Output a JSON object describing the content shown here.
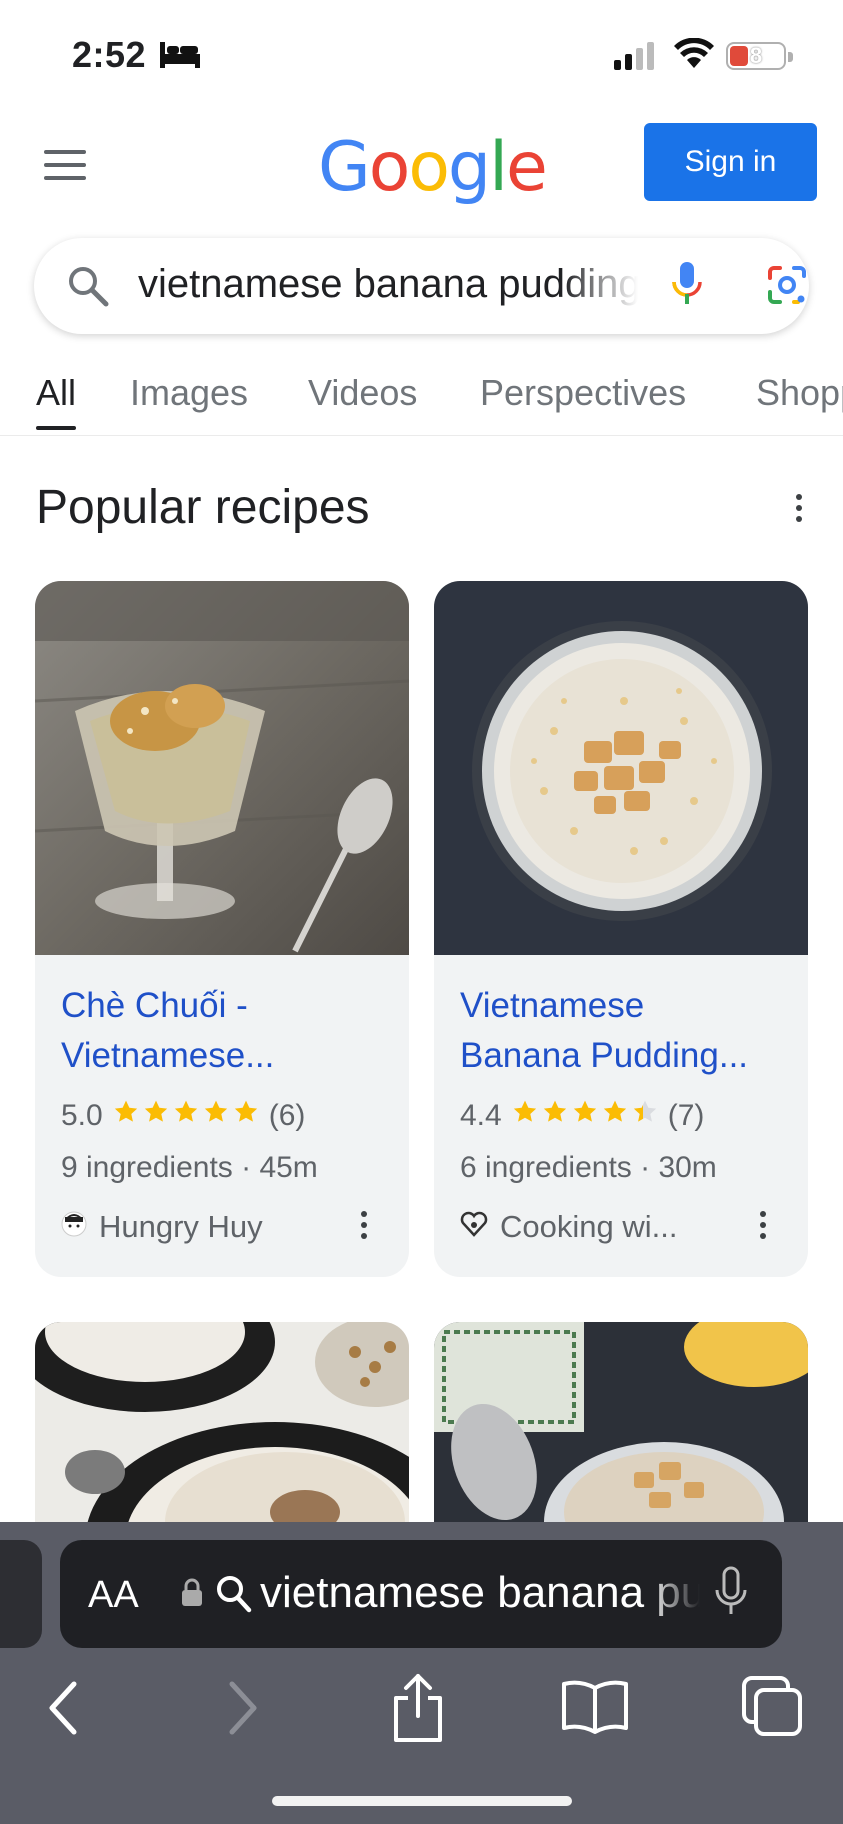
{
  "status_bar": {
    "time": "2:52",
    "battery_level": "8",
    "icons": [
      "sleep-bed-icon",
      "cellular-signal-icon",
      "wifi-icon",
      "battery-icon"
    ]
  },
  "header": {
    "logo_letters": [
      "G",
      "o",
      "o",
      "g",
      "l",
      "e"
    ],
    "sign_in_label": "Sign in",
    "icons": [
      "hamburger-menu-icon"
    ]
  },
  "search": {
    "query": "vietnamese banana pudding",
    "icons": [
      "search-icon",
      "voice-search-icon",
      "google-lens-icon"
    ]
  },
  "tabs": [
    {
      "label": "All",
      "active": true
    },
    {
      "label": "Images",
      "active": false
    },
    {
      "label": "Videos",
      "active": false
    },
    {
      "label": "Perspectives",
      "active": false
    },
    {
      "label": "Shopping",
      "active": false
    }
  ],
  "section": {
    "title": "Popular recipes"
  },
  "recipes": [
    {
      "title_line1": "Chè Chuối -",
      "title_line2": "Vietnamese...",
      "rating": "5.0",
      "stars": 5.0,
      "reviews": "(6)",
      "meta": "9 ingredients · 45m",
      "source": "Hungry Huy"
    },
    {
      "title_line1": "Vietnamese",
      "title_line2": "Banana Pudding...",
      "rating": "4.4",
      "stars": 4.4,
      "reviews": "(7)",
      "meta": "6 ingredients · 30m",
      "source": "Cooking wi..."
    }
  ],
  "safari": {
    "text_size_label": "AA",
    "url": "vietnamese banana pudding",
    "icons": [
      "back-icon",
      "forward-icon",
      "share-icon",
      "bookmarks-icon",
      "tabs-icon"
    ]
  },
  "colors": {
    "google_blue": "#4285f4",
    "google_red": "#ea4335",
    "google_yellow": "#fbbc05",
    "google_green": "#34a853",
    "sign_in_button": "#1a73e8",
    "link_blue": "#1f50c8",
    "star": "#fbbc04"
  }
}
